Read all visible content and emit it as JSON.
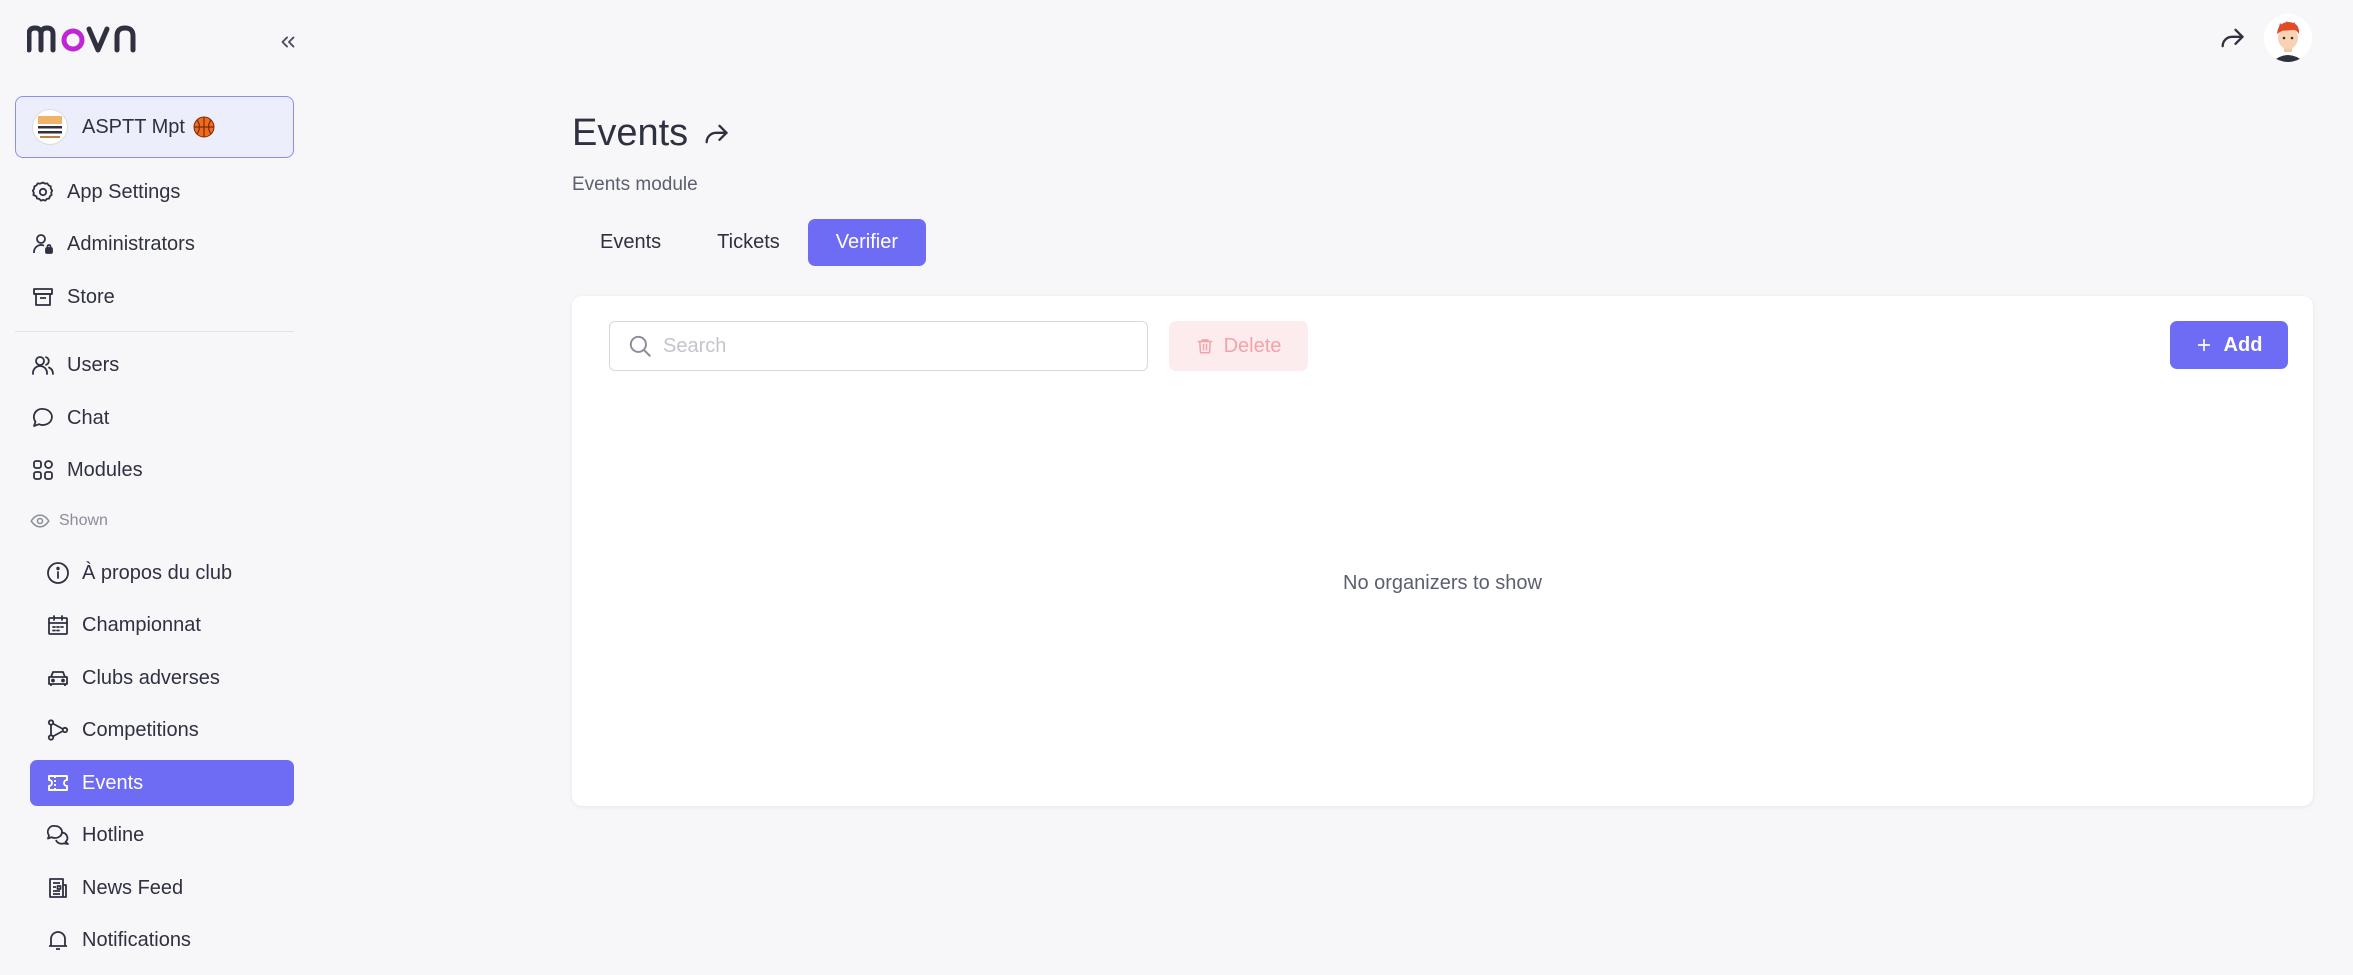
{
  "app": {
    "logo": "movn"
  },
  "org": {
    "name": "ASPTT Mpt"
  },
  "sidebar": {
    "main_items": [
      {
        "label": "App Settings",
        "icon": "gear-icon"
      },
      {
        "label": "Administrators",
        "icon": "user-lock-icon"
      },
      {
        "label": "Store",
        "icon": "store-icon"
      }
    ],
    "secondary_items": [
      {
        "label": "Users",
        "icon": "users-icon"
      },
      {
        "label": "Chat",
        "icon": "chat-bubble-icon"
      },
      {
        "label": "Modules",
        "icon": "grid-icon"
      }
    ],
    "shown_label": "Shown",
    "modules": [
      {
        "label": "À propos du club",
        "icon": "info-icon"
      },
      {
        "label": "Championnat",
        "icon": "calendar-icon"
      },
      {
        "label": "Clubs adverses",
        "icon": "car-icon"
      },
      {
        "label": "Competitions",
        "icon": "nodes-icon"
      },
      {
        "label": "Events",
        "icon": "ticket-icon",
        "active": true
      },
      {
        "label": "Hotline",
        "icon": "chats-icon"
      },
      {
        "label": "News Feed",
        "icon": "newspaper-icon"
      },
      {
        "label": "Notifications",
        "icon": "bell-icon"
      }
    ]
  },
  "page": {
    "title": "Events",
    "subtitle": "Events module",
    "tabs": [
      {
        "label": "Events",
        "active": false
      },
      {
        "label": "Tickets",
        "active": false
      },
      {
        "label": "Verifier",
        "active": true
      }
    ]
  },
  "toolbar": {
    "search_placeholder": "Search",
    "delete_label": "Delete",
    "add_label": "Add"
  },
  "content": {
    "empty_message": "No organizers to show"
  },
  "colors": {
    "accent": "#6e6cf5",
    "logo_accent": "#c026d3",
    "danger_light": "#fdeced"
  }
}
